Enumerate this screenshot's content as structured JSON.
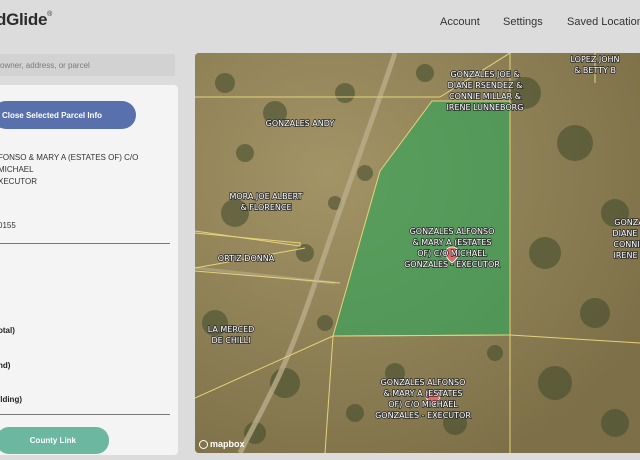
{
  "app": {
    "logo": "dGlide",
    "logo_mark": "®"
  },
  "nav": {
    "account": "Account",
    "settings": "Settings",
    "saved": "Saved Locations"
  },
  "search": {
    "placeholder": "owner, address, or parcel"
  },
  "panel": {
    "close_label": "Close Selected Parcel Info",
    "owner_line1": "FONSO & MARY A (ESTATES OF) C/O MICHAEL",
    "owner_line2": "XECUTOR",
    "parcel_id": "0155",
    "label_total": "otal)",
    "label_land": "nd)",
    "label_building": "ilding)",
    "county_label": "County Link"
  },
  "map": {
    "attribution": "mapbox",
    "labels": {
      "gonzales_andy": "GONZALES ANDY",
      "gonzales_joe_1": "GONZALES JOE &",
      "gonzales_joe_2": "DIANE RSENDEZ &",
      "gonzales_joe_3": "CONNIE MILLAR &",
      "gonzales_joe_4": "IRENE LUNNEBORG",
      "lopez_1": "LOPEZ JOHN",
      "lopez_2": "& BETTY B",
      "mora_1": "MORA JOE ALBERT",
      "mora_2": "& FLORENCE",
      "ortiz": "ORTIZ DONNA",
      "merced_1": "LA MERCED",
      "merced_2": "DE CHILLI",
      "sel_1": "GONZALES ALFONSO",
      "sel_2": "& MARY A (ESTATES",
      "sel_3": "OF) C/O MICHAEL",
      "sel_4": "GONZALES - EXECUTOR",
      "low_1": "GONZALES ALFONSO",
      "low_2": "& MARY A (ESTATES",
      "low_3": "OF) C/O MICHAEL",
      "low_4": "GONZALES - EXECUTOR",
      "right_1": "GONZA",
      "right_2": "DIANE R",
      "right_3": "CONNIE",
      "right_4": "IRENE L"
    },
    "colors": {
      "selected_fill": "#2fa65a",
      "boundary": "#e6d27a",
      "terrain": "#8f8055"
    }
  }
}
